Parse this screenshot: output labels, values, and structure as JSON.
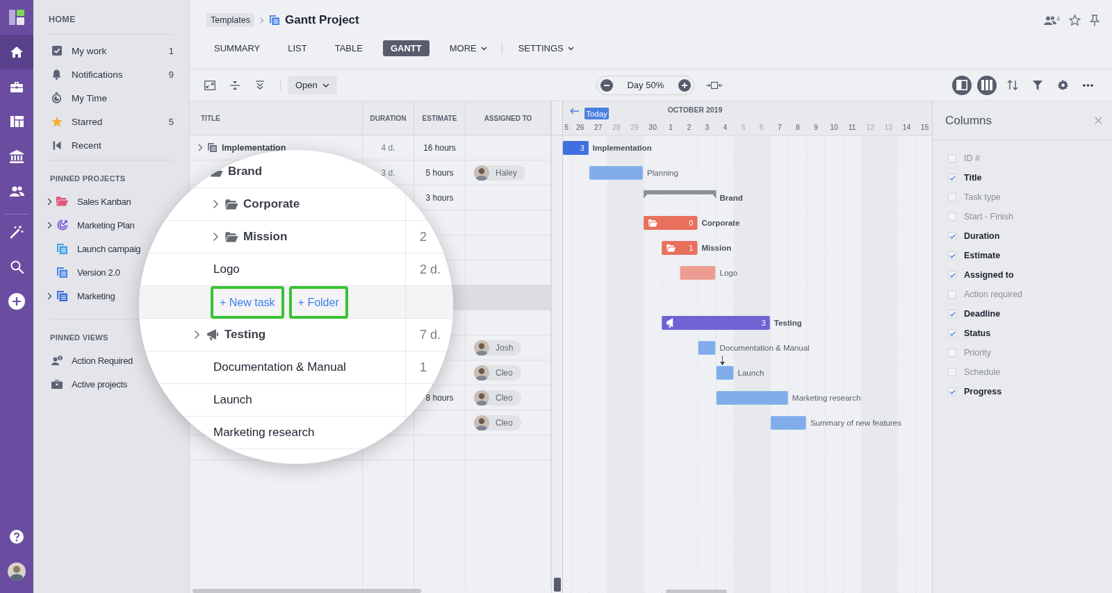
{
  "rail": {
    "items": [
      {
        "selected": true
      },
      {
        "selected": false
      },
      {
        "selected": false
      },
      {
        "selected": false
      },
      {
        "selected": false
      },
      {
        "selected": false
      },
      {
        "selected": false
      },
      {
        "selected": false
      }
    ]
  },
  "sidebar": {
    "home_heading": "HOME",
    "items": [
      {
        "label": "My work",
        "count": "1"
      },
      {
        "label": "Notifications",
        "count": "9"
      },
      {
        "label": "My Time"
      },
      {
        "label": "Starred",
        "count": "5"
      },
      {
        "label": "Recent"
      }
    ],
    "pinned_projects_heading": "PINNED PROJECTS",
    "pinned_projects": [
      {
        "label": "Sales Kanban",
        "expandable": true,
        "color": "#e0567a"
      },
      {
        "label": "Marketing Plan",
        "expandable": true,
        "color": "#7b5ce0"
      },
      {
        "label": "Launch campaig",
        "expandable": false,
        "color": "#3fa3e8"
      },
      {
        "label": "Version 2.0",
        "expandable": false,
        "color": "#4a86e8"
      },
      {
        "label": "Marketing",
        "expandable": true,
        "color": "#3b6fd8"
      }
    ],
    "pinned_views_heading": "PINNED VIEWS",
    "pinned_views": [
      {
        "label": "Action Required"
      },
      {
        "label": "Active projects"
      }
    ]
  },
  "header": {
    "breadcrumb": "Templates",
    "title": "Gantt Project",
    "collaborators_count": "4",
    "tabs": [
      {
        "label": "SUMMARY",
        "selected": false,
        "dropdown": false
      },
      {
        "label": "LIST",
        "selected": false,
        "dropdown": false
      },
      {
        "label": "TABLE",
        "selected": false,
        "dropdown": false
      },
      {
        "label": "GANTT",
        "selected": true,
        "dropdown": false
      },
      {
        "label": "MORE",
        "selected": false,
        "dropdown": true
      },
      {
        "label": "SETTINGS",
        "selected": false,
        "dropdown": true
      }
    ]
  },
  "toolbar": {
    "open_menu": "Open",
    "zoom_label": "Day 50%"
  },
  "table": {
    "columns": [
      "TITLE",
      "DURATION",
      "ESTIMATE",
      "ASSIGNED TO"
    ],
    "rows": [
      {
        "title": "Implementation",
        "expandable": true,
        "duration": "4 d.",
        "estimate": "16 hours",
        "highlighted": false
      },
      {
        "duration": "3 d.",
        "estimate": "5 hours",
        "assignee": "Haley",
        "highlighted": false
      },
      {
        "estimate": "3 hours",
        "highlighted": false
      },
      {
        "highlighted": false
      },
      {
        "highlighted": false
      },
      {
        "highlighted": false
      },
      {
        "highlighted": true
      },
      {
        "highlighted": false
      },
      {
        "assignee": "Josh",
        "highlighted": false
      },
      {
        "assignee": "Cleo",
        "highlighted": false
      },
      {
        "estimate": "8 hours",
        "assignee": "Cleo",
        "highlighted": false
      },
      {
        "assignee": "Cleo",
        "highlighted": false
      },
      {
        "highlighted": false
      }
    ]
  },
  "magnifier": {
    "rows": [
      {
        "label": "Brand",
        "kind": "folder",
        "expandable": false,
        "children": [
          {
            "label": "Corporate",
            "kind": "folder",
            "expandable": true
          },
          {
            "label": "Mission",
            "kind": "folder",
            "expandable": true,
            "duration": "2"
          },
          {
            "label": "Logo",
            "kind": "task",
            "duration": "2 d."
          },
          {
            "kind": "add",
            "new_task": "+ New task",
            "new_folder": "+ Folder"
          }
        ]
      },
      {
        "label": "Testing",
        "kind": "megaphone",
        "expandable": true,
        "duration": "7 d.",
        "children": [
          {
            "label": "Documentation & Manual",
            "kind": "task",
            "duration": "1"
          },
          {
            "label": "Launch",
            "kind": "task"
          },
          {
            "label": "Marketing research",
            "kind": "task"
          }
        ]
      }
    ]
  },
  "gantt": {
    "today": "Today",
    "days": [
      {
        "label": "5",
        "weekend": false
      },
      {
        "label": "26",
        "weekend": false
      },
      {
        "label": "27",
        "weekend": false
      },
      {
        "label": "28",
        "weekend": true
      },
      {
        "label": "29",
        "weekend": true
      },
      {
        "label": "30",
        "weekend": false
      },
      {
        "label": "1",
        "weekend": false
      },
      {
        "label": "2",
        "weekend": false
      },
      {
        "label": "3",
        "weekend": false
      },
      {
        "label": "4",
        "weekend": false
      },
      {
        "label": "5",
        "weekend": true
      },
      {
        "label": "6",
        "weekend": true
      },
      {
        "label": "7",
        "weekend": false
      },
      {
        "label": "8",
        "weekend": false
      },
      {
        "label": "9",
        "weekend": false
      },
      {
        "label": "10",
        "weekend": false
      },
      {
        "label": "11",
        "weekend": false
      },
      {
        "label": "12",
        "weekend": true
      },
      {
        "label": "13",
        "weekend": true
      },
      {
        "label": "14",
        "weekend": false
      },
      {
        "label": "15",
        "weekend": false
      }
    ],
    "month": "OCTOBER 2019",
    "bars": [
      {
        "label": "Implementation",
        "kind": "summary",
        "color": "#3f6fe0",
        "count": "3"
      },
      {
        "label": "Planning",
        "kind": "task",
        "color": "#80adea"
      },
      {
        "label": "Brand",
        "kind": "bracket",
        "color": "#8a9097"
      },
      {
        "label": "Corporate",
        "kind": "folder",
        "color": "#e8705c",
        "count": "0"
      },
      {
        "label": "Mission",
        "kind": "folder",
        "color": "#e8705c",
        "count": "1"
      },
      {
        "label": "Logo",
        "kind": "task",
        "color": "#ec9c90"
      },
      {
        "kind": "blank"
      },
      {
        "label": "Testing",
        "kind": "megaphone",
        "color": "#6f63d3",
        "count": "3"
      },
      {
        "label": "Documentation & Manual",
        "kind": "task",
        "color": "#80adea"
      },
      {
        "label": "Launch",
        "kind": "task",
        "color": "#80adea",
        "linked": true
      },
      {
        "label": "Marketing research",
        "kind": "task",
        "color": "#80adea"
      },
      {
        "label": "Summary of new features",
        "kind": "task",
        "color": "#80adea"
      }
    ]
  },
  "columns_panel": {
    "title": "Columns",
    "items": [
      {
        "label": "ID #",
        "checked": false
      },
      {
        "label": "Title",
        "checked": true
      },
      {
        "label": "Task type",
        "checked": false
      },
      {
        "label": "Start - Finish",
        "checked": false
      },
      {
        "label": "Duration",
        "checked": true
      },
      {
        "label": "Estimate",
        "checked": true
      },
      {
        "label": "Assigned to",
        "checked": true
      },
      {
        "label": "Action required",
        "checked": false
      },
      {
        "label": "Deadline",
        "checked": true
      },
      {
        "label": "Status",
        "checked": true
      },
      {
        "label": "Priority",
        "checked": false
      },
      {
        "label": "Schedule",
        "checked": false
      },
      {
        "label": "Progress",
        "checked": true
      }
    ]
  }
}
